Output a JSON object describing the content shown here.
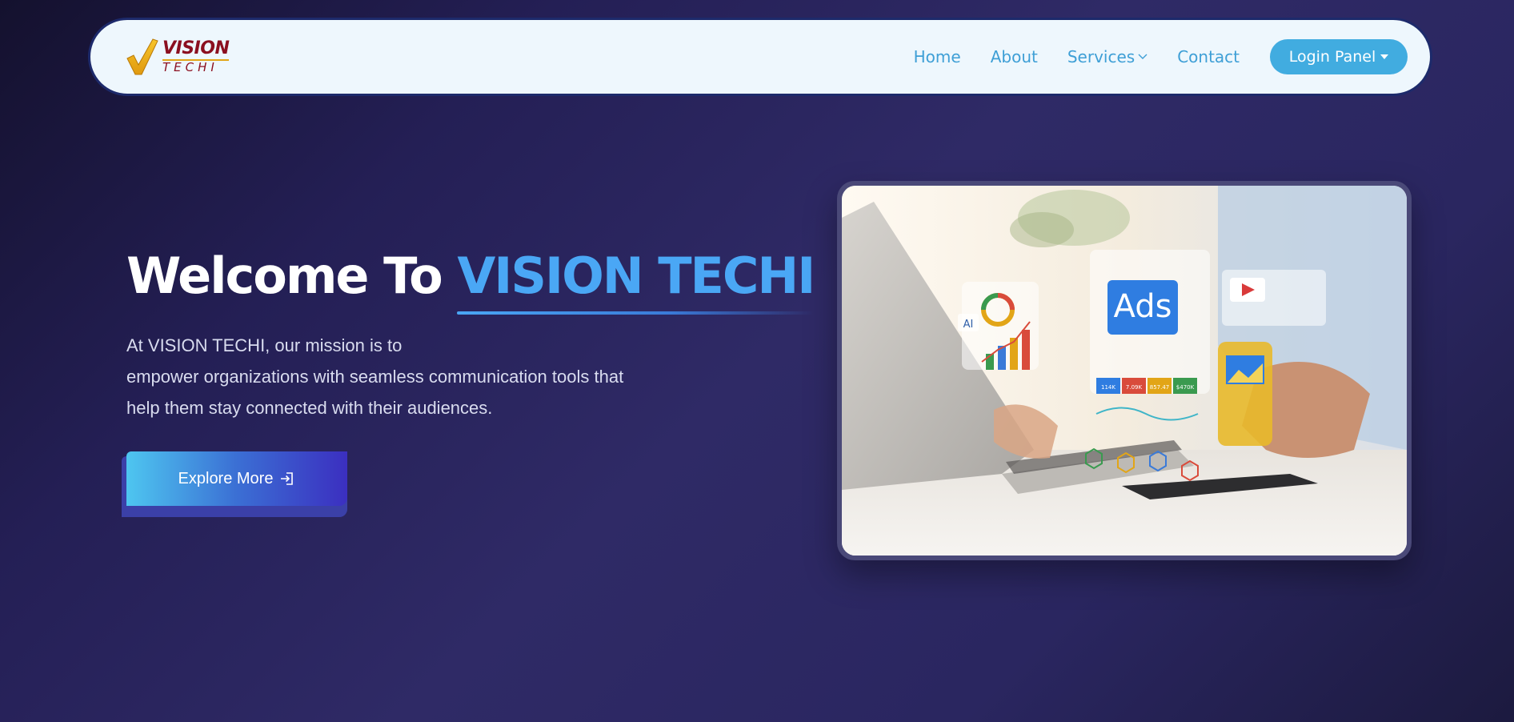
{
  "brand": {
    "logo_word1": "VISION",
    "logo_word2": "TECHI",
    "logo_icon": "checkmark-logo-icon"
  },
  "nav": {
    "items": [
      {
        "label": "Home"
      },
      {
        "label": "About"
      },
      {
        "label": "Services"
      },
      {
        "label": "Contact"
      }
    ],
    "login_label": "Login Panel"
  },
  "hero": {
    "title_prefix": "Welcome To",
    "title_accent": "VISION TECHI",
    "description_lines": [
      "At VISION TECHI, our mission is to",
      "empower organizations with seamless communication tools that",
      "help them stay connected with their audiences."
    ],
    "cta_label": "Explore More",
    "cta_icon": "sign-in-icon"
  },
  "image": {
    "ads_label": "Ads",
    "ai_label": "AI",
    "stat_values": [
      "114K",
      "7.09K",
      "857.47",
      "$470K"
    ]
  },
  "colors": {
    "nav_link": "#3e9fd6",
    "login_bg": "#41ace0",
    "accent": "#4aa7f5",
    "logo_red": "#8b0f1f",
    "logo_gold": "#e2a517"
  }
}
